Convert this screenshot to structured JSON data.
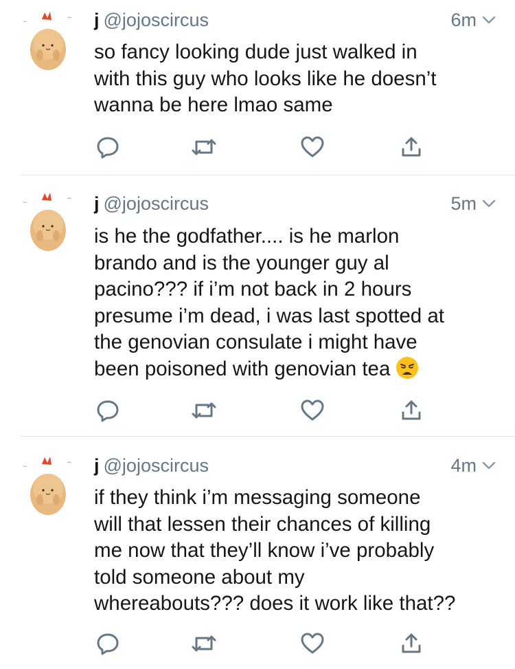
{
  "tweets": [
    {
      "name": "j",
      "handle": "@jojoscircus",
      "time": "6m",
      "text": "so fancy looking dude just walked in\nwith this guy who looks like he doesn’t\nwanna be here lmao same"
    },
    {
      "name": "j",
      "handle": "@jojoscircus",
      "time": "5m",
      "text": "is he the godfather.... is he marlon\nbrando and is the younger guy al\npacino??? if i’m not back in 2 hours\npresume i’m dead, i was last spotted at\nthe genovian consulate i might have\nbeen poisoned with genovian tea",
      "emoji": "weary-face-emoji"
    },
    {
      "name": "j",
      "handle": "@jojoscircus",
      "time": "4m",
      "text": "if they think i’m messaging someone\nwill that lessen their chances of killing\nme now that they’ll know i’ve probably\ntold someone about my\nwhereabouts??? does it work like that??"
    }
  ],
  "icons": {
    "reply": "reply-icon",
    "retweet": "retweet-icon",
    "like": "heart-icon",
    "share": "share-icon",
    "more": "chevron-down-icon",
    "avatar": "fried-shrimp-plush-avatar"
  },
  "colors": {
    "icon_gray": "#657786",
    "divider": "#e1e8ed",
    "text": "#14171a",
    "avatar_body": "#e8b97e",
    "avatar_tail": "#e04a2a"
  }
}
